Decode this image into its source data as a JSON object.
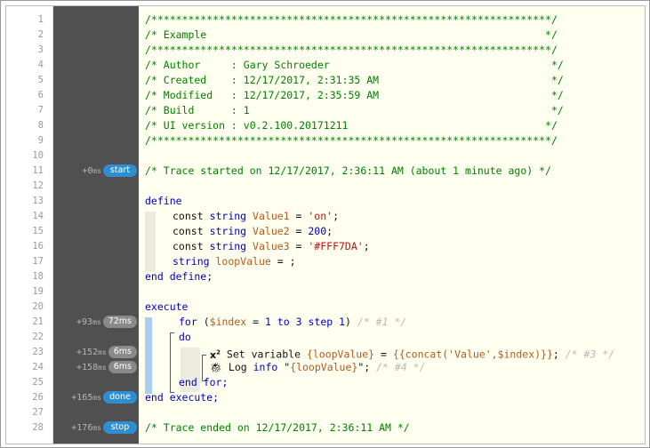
{
  "lines": [
    {
      "n": "1",
      "text": "/*****************************************************************/"
    },
    {
      "n": "2",
      "text": "/* Example                                                       */"
    },
    {
      "n": "3",
      "text": "/*****************************************************************/"
    },
    {
      "n": "4",
      "text": "/* Author     : Gary Schroeder                                    */"
    },
    {
      "n": "5",
      "text": "/* Created    : 12/17/2017, 2:31:35 AM                            */"
    },
    {
      "n": "6",
      "text": "/* Modified   : 12/17/2017, 2:35:59 AM                            */"
    },
    {
      "n": "7",
      "text": "/* Build      : 1                                                 */"
    },
    {
      "n": "8",
      "text": "/* UI version : v0.2.100.20171211                                */"
    },
    {
      "n": "9",
      "text": "/*****************************************************************/"
    },
    {
      "n": "10",
      "text": ""
    },
    {
      "n": "11",
      "text": "/* Trace started on 12/17/2017, 2:36:11 AM (about 1 minute ago) */"
    },
    {
      "n": "12",
      "text": ""
    },
    {
      "n": "13"
    },
    {
      "n": "14"
    },
    {
      "n": "15"
    },
    {
      "n": "16"
    },
    {
      "n": "17"
    },
    {
      "n": "18"
    },
    {
      "n": "19",
      "text": ""
    },
    {
      "n": "20"
    },
    {
      "n": "21"
    },
    {
      "n": "22"
    },
    {
      "n": "23"
    },
    {
      "n": "24"
    },
    {
      "n": "25"
    },
    {
      "n": "26"
    },
    {
      "n": "27",
      "text": ""
    },
    {
      "n": "28",
      "text": "/* Trace ended on 12/17/2017, 2:36:11 AM */"
    }
  ],
  "code": {
    "define": "define",
    "const": "const",
    "string": "string",
    "v1": "Value1",
    "v2": "Value2",
    "v3": "Value3",
    "loop": "loopValue",
    "eq": " = ",
    "v1val": "'on'",
    "v2val": "200",
    "v3val": "'#FFF7DA'",
    "semi": ";",
    "loop_tail": " = ;",
    "end_define": "end define;",
    "execute": "execute",
    "for_kw": "for",
    "for_open": " (",
    "index": "$index",
    "for_eq": " = ",
    "one": "1",
    "to": " to ",
    "three": "3",
    "step": " step ",
    "for_close": ")",
    "for_comment": " /* #1 */",
    "do": "do",
    "set_label": " Set variable ",
    "set_var": "{loopValue}",
    "set_eq": " = ",
    "set_expr": "{{concat('Value',$index)}}",
    "set_semi": ";",
    "set_comment": " /* #3 */",
    "log_label": " Log ",
    "log_info": "info",
    "log_open": " \"",
    "log_var": "{loopValue}",
    "log_close": "\";",
    "log_comment": " /* #4 */",
    "end_for": "end for;",
    "end_execute": "end execute;"
  },
  "trace": {
    "start": {
      "time": "+0",
      "unit": "ms",
      "badge": "start"
    },
    "for": {
      "time": "+93",
      "unit": "ms",
      "badge": "72ms"
    },
    "set": {
      "time": "+152",
      "unit": "ms",
      "badge": "6ms"
    },
    "log": {
      "time": "+158",
      "unit": "ms",
      "badge": "6ms"
    },
    "done": {
      "time": "+165",
      "unit": "ms",
      "badge": "done"
    },
    "stop": {
      "time": "+176",
      "unit": "ms",
      "badge": "stop"
    }
  },
  "icons": {
    "set": "x-squared-icon",
    "log": "bug-icon"
  },
  "colors": {
    "badge_blue": "#2f8ed1",
    "badge_gray": "#8a8a8a",
    "comment": "#008000",
    "keyword": "#0000c0",
    "variable": "#b35a1f",
    "string": "#c01010",
    "gutter": "#505050",
    "background": "#fffff0"
  }
}
